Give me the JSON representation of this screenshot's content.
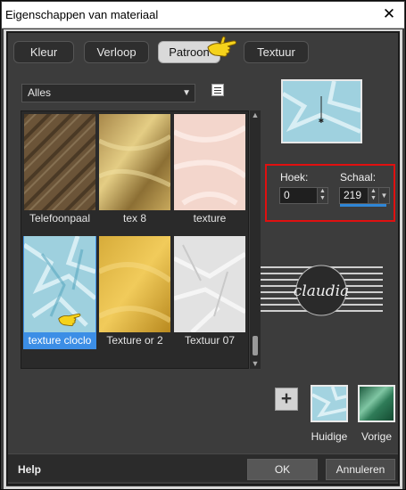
{
  "window": {
    "title": "Eigenschappen van materiaal",
    "close_glyph": "✕"
  },
  "tabs": [
    {
      "label": "Kleur",
      "active": false
    },
    {
      "label": "Verloop",
      "active": false
    },
    {
      "label": "Patroon",
      "active": true
    },
    {
      "label": "Textuur",
      "active": false
    }
  ],
  "category": {
    "value": "Alles",
    "icon": "chevron-down-icon"
  },
  "gallery": {
    "items": [
      {
        "label": "Telefoonpaal",
        "selected": false
      },
      {
        "label": "tex 8",
        "selected": false
      },
      {
        "label": "texture",
        "selected": false
      },
      {
        "label": "texture cloclo",
        "selected": true
      },
      {
        "label": "Texture or 2",
        "selected": false
      },
      {
        "label": "Textuur 07",
        "selected": false
      }
    ]
  },
  "controls": {
    "angle_label": "Hoek:",
    "angle_value": "0",
    "scale_label": "Schaal:",
    "scale_value": "219"
  },
  "watermark": {
    "text": "claudia"
  },
  "swatches": {
    "current_label": "Huidige",
    "previous_label": "Vorige"
  },
  "footer": {
    "help": "Help",
    "ok": "OK",
    "cancel": "Annuleren"
  },
  "colors": {
    "accent": "#2f86d6",
    "highlight": "#e01010",
    "selection": "#3c8ee6"
  }
}
